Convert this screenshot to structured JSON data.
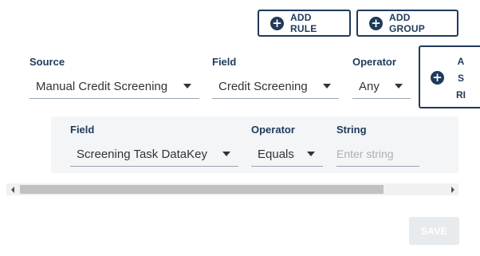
{
  "toolbar": {
    "add_rule_label": "ADD RULE",
    "add_group_label": "ADD GROUP"
  },
  "rule": {
    "source": {
      "label": "Source",
      "value": "Manual Credit Screening"
    },
    "field": {
      "label": "Field",
      "value": "Credit Screening"
    },
    "operator": {
      "label": "Operator",
      "value": "Any"
    },
    "add_sub_rule_lines": [
      "A",
      "S",
      "RI"
    ]
  },
  "sub_rule": {
    "field": {
      "label": "Field",
      "value": "Screening Task DataKey"
    },
    "operator": {
      "label": "Operator",
      "value": "Equals"
    },
    "string": {
      "label": "String",
      "value": "",
      "placeholder": "Enter string"
    }
  },
  "footer": {
    "save_label": "SAVE"
  },
  "colors": {
    "accent": "#1f3a5a",
    "panel_bg": "#f3f5f7",
    "disabled_button": "#e8ebee"
  },
  "icons": {
    "add": "plus-circle-icon",
    "dropdown": "caret-down-icon"
  }
}
